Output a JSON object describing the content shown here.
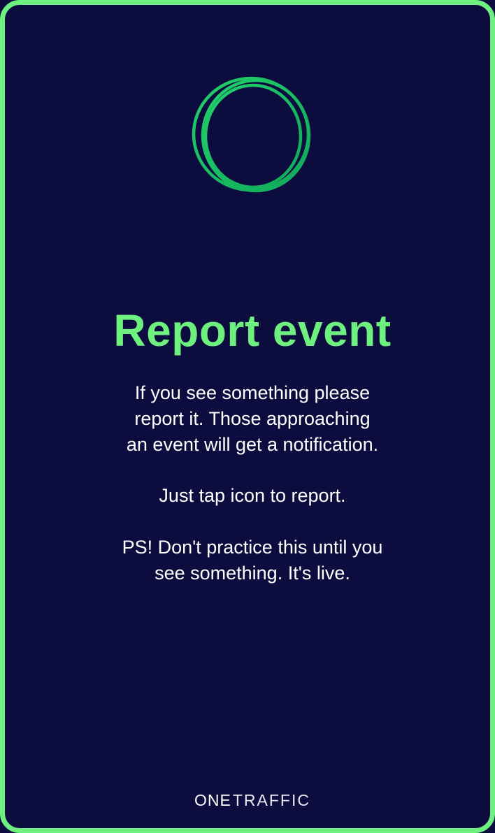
{
  "colors": {
    "background": "#0c0c3e",
    "accent": "#6ef07e",
    "text": "#ffffff"
  },
  "icon": "report-event-rings-icon",
  "title": "Report event",
  "description": {
    "lines": [
      "If you see something please",
      "report it. Those approaching",
      "an event will get a notification."
    ]
  },
  "instruction": "Just tap icon to report.",
  "warning": {
    "lines": [
      "PS! Don't practice this until you",
      "see something. It's live."
    ]
  },
  "brand": {
    "part1": "ONE",
    "part2": "TRAFFIC"
  }
}
